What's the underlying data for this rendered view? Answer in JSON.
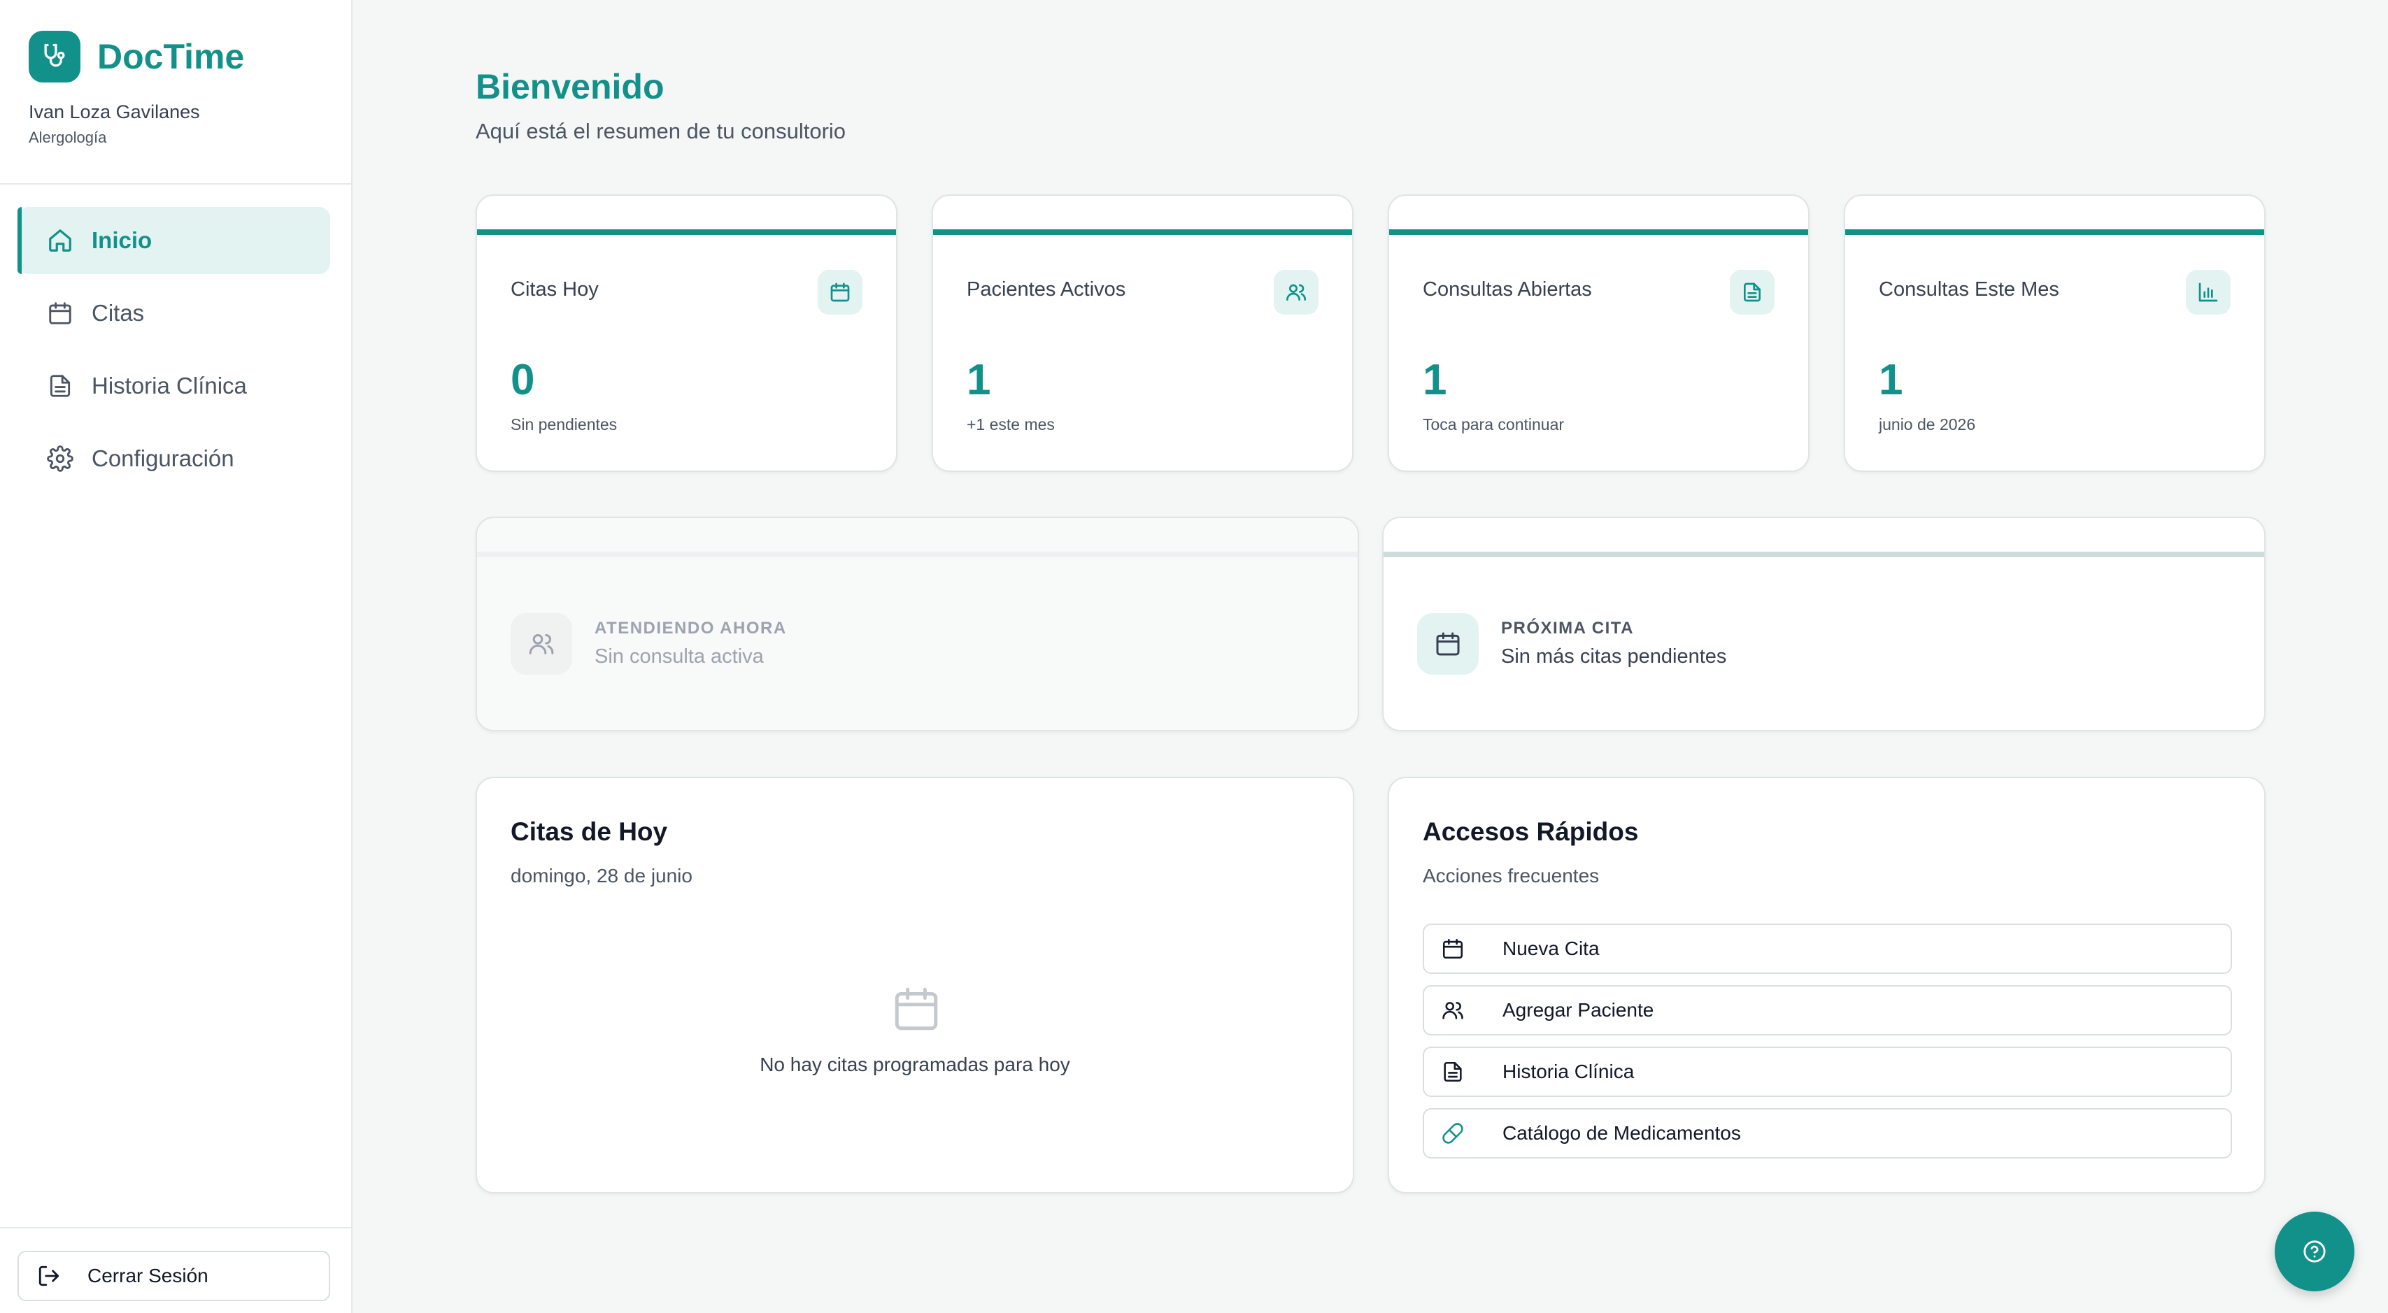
{
  "sidebar": {
    "brand": "DocTime",
    "user_name": "Ivan Loza Gavilanes",
    "user_specialty": "Alergología",
    "nav": [
      {
        "label": "Inicio",
        "icon": "home-icon",
        "active": true
      },
      {
        "label": "Citas",
        "icon": "calendar-icon",
        "active": false
      },
      {
        "label": "Historia Clínica",
        "icon": "document-icon",
        "active": false
      },
      {
        "label": "Configuración",
        "icon": "gear-icon",
        "active": false
      }
    ],
    "logout_label": "Cerrar Sesión"
  },
  "header": {
    "title": "Bienvenido",
    "subtitle": "Aquí está el resumen de tu consultorio"
  },
  "stats": [
    {
      "label": "Citas Hoy",
      "value": "0",
      "sub": "Sin pendientes",
      "icon": "calendar-icon"
    },
    {
      "label": "Pacientes Activos",
      "value": "1",
      "sub": "+1 este mes",
      "icon": "users-icon"
    },
    {
      "label": "Consultas Abiertas",
      "value": "1",
      "sub": "Toca para continuar",
      "icon": "document-icon"
    },
    {
      "label": "Consultas Este Mes",
      "value": "1",
      "sub": "junio de 2026",
      "icon": "bar-chart-icon"
    }
  ],
  "status": {
    "current": {
      "title": "ATENDIENDO AHORA",
      "sub": "Sin consulta activa",
      "icon": "users-icon"
    },
    "next": {
      "title": "PRÓXIMA CITA",
      "sub": "Sin más citas pendientes",
      "icon": "calendar-icon"
    }
  },
  "today": {
    "title": "Citas de Hoy",
    "date": "domingo, 28 de junio",
    "empty_text": "No hay citas programadas para hoy"
  },
  "quick_access": {
    "title": "Accesos Rápidos",
    "subtitle": "Acciones frecuentes",
    "items": [
      {
        "label": "Nueva Cita",
        "icon": "calendar-icon"
      },
      {
        "label": "Agregar Paciente",
        "icon": "users-icon"
      },
      {
        "label": "Historia Clínica",
        "icon": "document-icon"
      },
      {
        "label": "Catálogo de Medicamentos",
        "icon": "pill-icon"
      }
    ]
  },
  "colors": {
    "brand": "#12918a",
    "brand_light": "#e3f3f2",
    "background": "#f5f7f7"
  }
}
